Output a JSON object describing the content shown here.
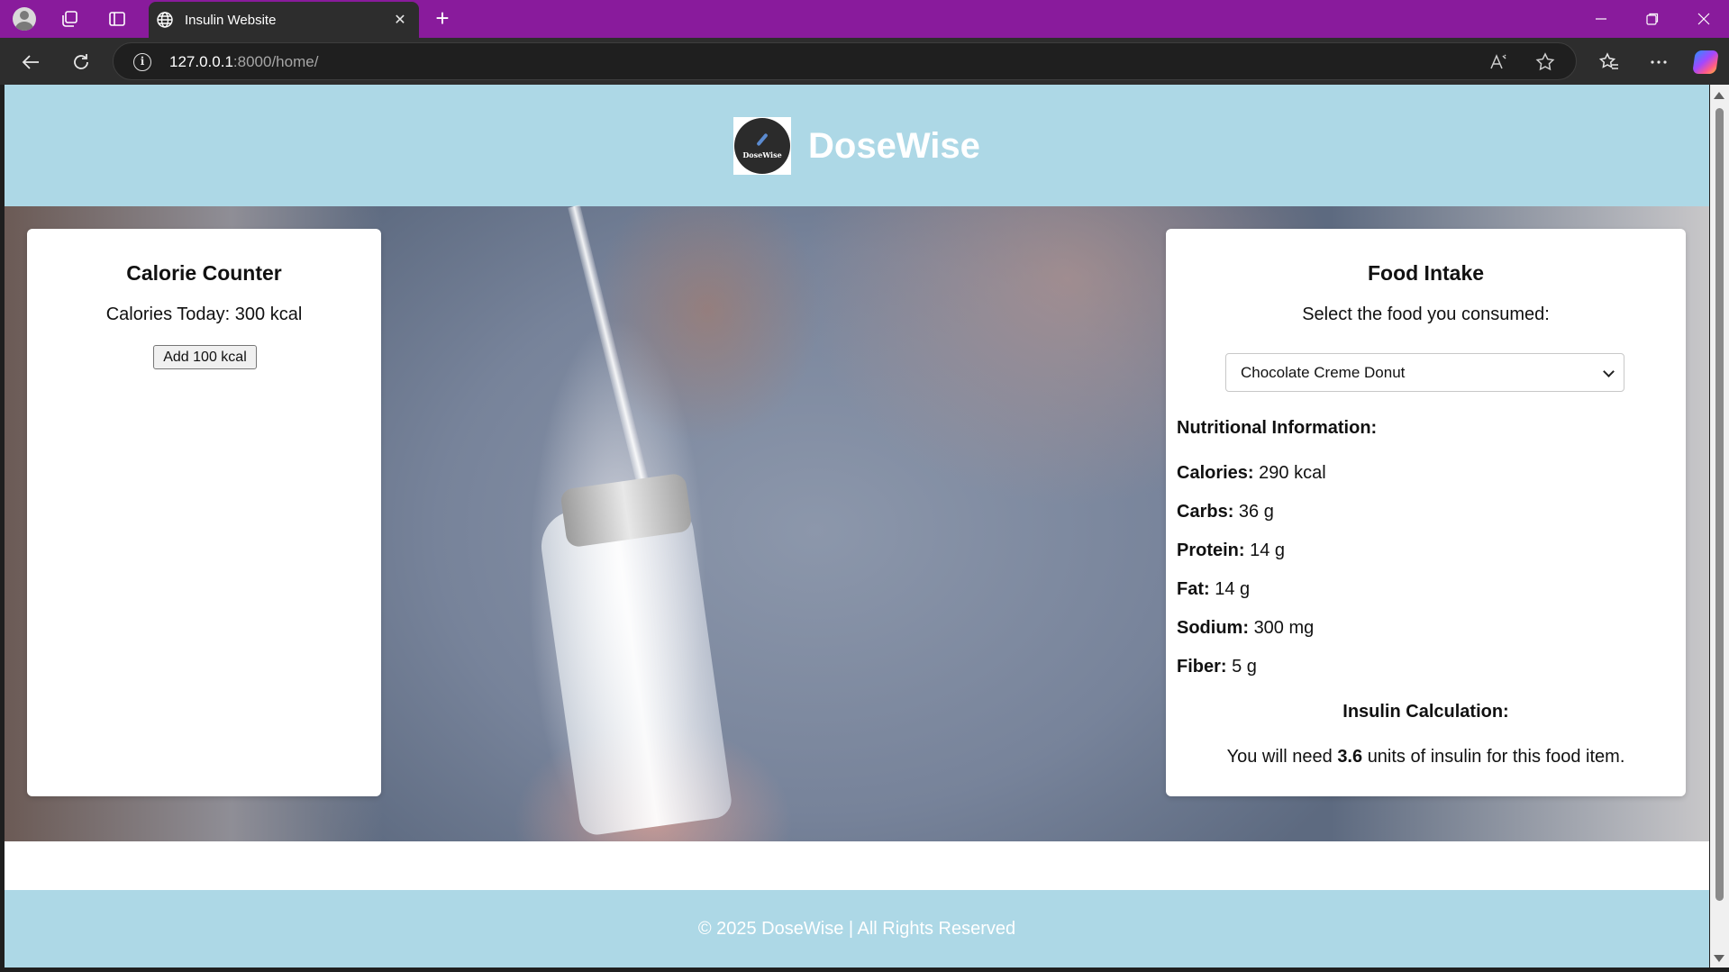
{
  "browser": {
    "tab_title": "Insulin Website",
    "url_host": "127.0.0.1",
    "url_path": ":8000/home/",
    "new_tab_glyph": "+",
    "close_glyph": "✕",
    "icons": [
      "profile-icon",
      "workspaces-icon",
      "tab-actions-icon",
      "globe-icon",
      "back-icon",
      "refresh-icon",
      "info-icon",
      "read-aloud-icon",
      "favorite-star-icon",
      "favorites-icon",
      "more-icon",
      "copilot-icon"
    ]
  },
  "site": {
    "title": "DoseWise",
    "logo_text": "DoseWise",
    "header_color": "#add8e6"
  },
  "calorie_counter": {
    "title": "Calorie Counter",
    "calories_label": "Calories Today:",
    "calories_value": "300 kcal",
    "add_button": "Add 100 kcal"
  },
  "food_intake": {
    "title": "Food Intake",
    "prompt": "Select the food you consumed:",
    "selected_food": "Chocolate Creme Donut",
    "nutrition_heading": "Nutritional Information:",
    "nutrition": [
      {
        "label": "Calories:",
        "value": "290 kcal"
      },
      {
        "label": "Carbs:",
        "value": "36 g"
      },
      {
        "label": "Protein:",
        "value": "14 g"
      },
      {
        "label": "Fat:",
        "value": "14 g"
      },
      {
        "label": "Sodium:",
        "value": "300 mg"
      },
      {
        "label": "Fiber:",
        "value": "5 g"
      }
    ],
    "insulin_heading": "Insulin Calculation:",
    "insulin_prefix": "You will need",
    "insulin_units": "3.6",
    "insulin_suffix": "units of insulin for this food item."
  },
  "footer": {
    "text": "© 2025 DoseWise | All Rights Reserved"
  }
}
